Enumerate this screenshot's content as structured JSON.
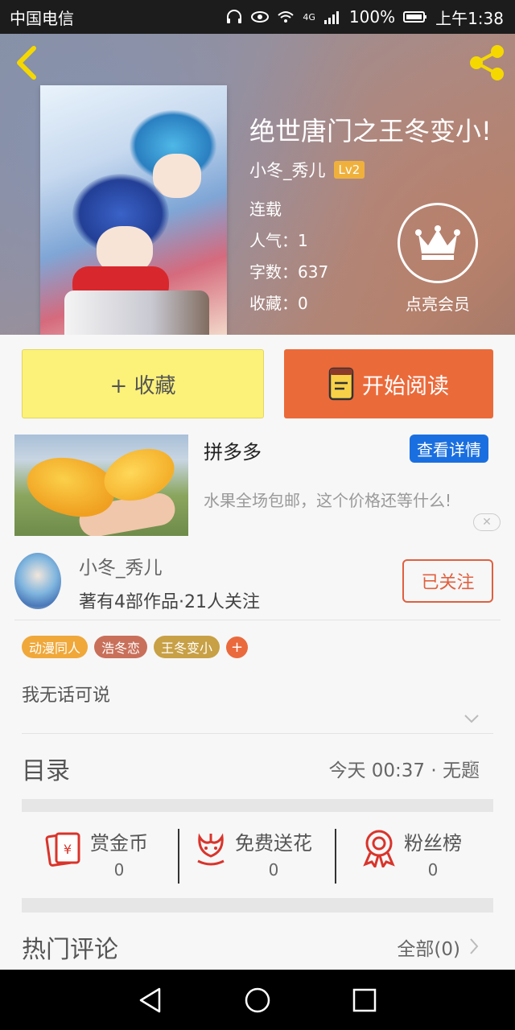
{
  "status_bar": {
    "carrier": "中国电信",
    "network": "4G",
    "battery": "100%",
    "time": "上午1:38"
  },
  "book": {
    "title": "绝世唐门之王冬变小!",
    "author": "小冬_秀儿",
    "author_level": "Lv2",
    "status": "连载",
    "popularity": "人气：1",
    "word_count": "字数：637",
    "favorites": "收藏：0"
  },
  "vip": {
    "label": "点亮会员"
  },
  "actions": {
    "collect_label": "+ 收藏",
    "read_label": "开始阅读"
  },
  "ad": {
    "title": "拼多多",
    "detail_label": "查看详情",
    "description": "水果全场包邮，这个价格还等什么!",
    "close_glyph": "✕"
  },
  "author_profile": {
    "name": "小冬_秀儿",
    "meta": "著有4部作品·21人关注",
    "follow_label": "已关注"
  },
  "tags": [
    {
      "label": "动漫同人",
      "color": "#f0a83a"
    },
    {
      "label": "浩冬恋",
      "color": "#c9705a"
    },
    {
      "label": "王冬变小",
      "color": "#c8a045"
    }
  ],
  "tag_add": "+",
  "description": "我无话可说",
  "toc": {
    "label": "目录",
    "latest": "今天 00:37 · 无题"
  },
  "stats": [
    {
      "label": "赏金币",
      "value": "0",
      "icon": "red-envelope-icon"
    },
    {
      "label": "免费送花",
      "value": "0",
      "icon": "flower-icon"
    },
    {
      "label": "粉丝榜",
      "value": "0",
      "icon": "medal-icon"
    }
  ],
  "comments": {
    "label": "热门评论",
    "all_label": "全部(0)"
  },
  "colors": {
    "accent": "#eb6a3a",
    "collect_bg": "#fcf27a",
    "ad_blue": "#1a6fe0",
    "level_badge": "#f0b13c"
  }
}
